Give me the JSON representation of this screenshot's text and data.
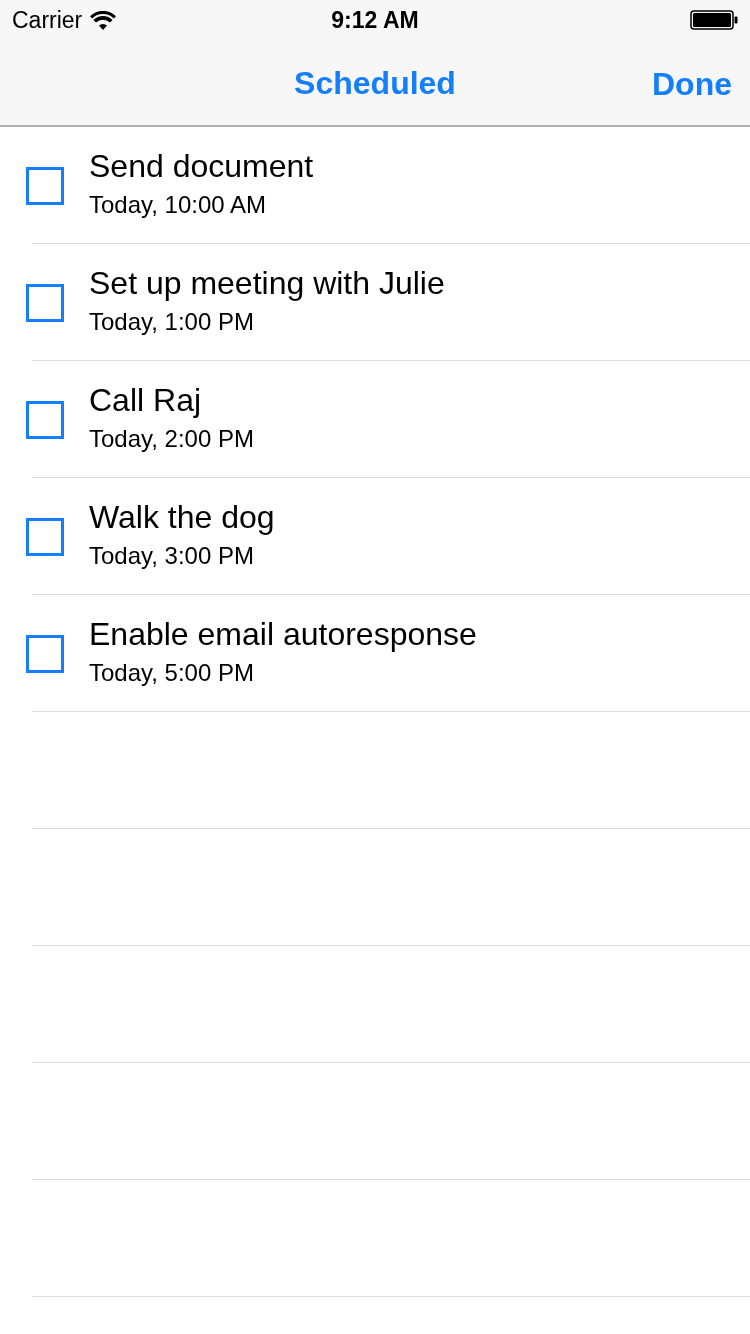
{
  "status_bar": {
    "carrier": "Carrier",
    "time": "9:12 AM"
  },
  "nav_bar": {
    "title": "Scheduled",
    "done": "Done"
  },
  "tasks": [
    {
      "title": "Send document",
      "due": "Today, 10:00 AM",
      "checked": false
    },
    {
      "title": "Set up meeting with Julie",
      "due": "Today, 1:00 PM",
      "checked": false
    },
    {
      "title": "Call Raj",
      "due": "Today, 2:00 PM",
      "checked": false
    },
    {
      "title": "Walk the dog",
      "due": "Today, 3:00 PM",
      "checked": false
    },
    {
      "title": "Enable email autoresponse",
      "due": "Today, 5:00 PM",
      "checked": false
    }
  ]
}
